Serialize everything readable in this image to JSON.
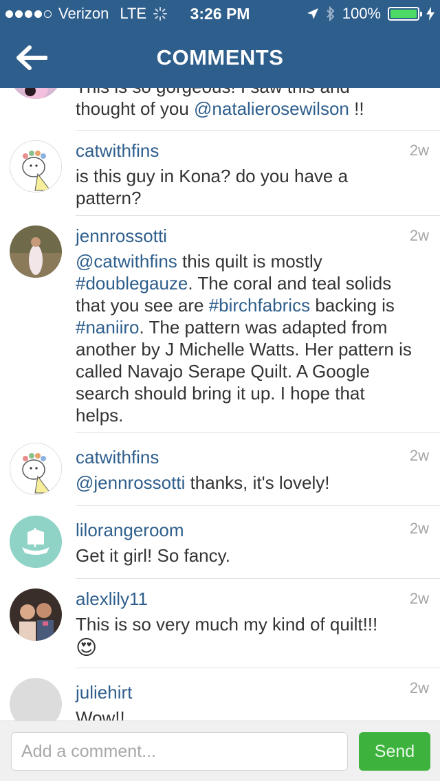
{
  "status_bar": {
    "carrier": "Verizon",
    "network": "LTE",
    "time": "3:26 PM",
    "battery": "100%"
  },
  "nav": {
    "title": "COMMENTS"
  },
  "comments": [
    {
      "partial": true,
      "username": "",
      "time": "",
      "line1": "This is so gorgeous! I saw this and",
      "line2_prefix": "thought of you ",
      "mention": "@natalierosewilson",
      "line2_suffix": " !!"
    },
    {
      "username": "catwithfins",
      "time": "2w",
      "text": "is this guy in Kona? do you have a pattern?"
    },
    {
      "username": "jennrossotti",
      "time": "2w",
      "m1": "@catwithfins",
      "t1": " this quilt is mostly ",
      "m2": "#doublegauze",
      "t2": ". The coral and teal solids that you see are ",
      "m3": "#birchfabrics",
      "t3": " backing is ",
      "m4": "#naniiro",
      "t4": ". The pattern was adapted from another by J Michelle Watts. Her pattern is called Navajo Serape Quilt. A Google search should bring it up. I hope that helps."
    },
    {
      "username": "catwithfins",
      "time": "2w",
      "mention": "@jennrossotti",
      "text": " thanks, it's lovely!"
    },
    {
      "username": "lilorangeroom",
      "time": "2w",
      "text": "Get it girl! So fancy."
    },
    {
      "username": "alexlily11",
      "time": "2w",
      "text": "This is so very much my kind of quilt!!!",
      "emoji": "😍"
    },
    {
      "username": "juliehirt",
      "time": "2w",
      "text": "Wow!!"
    }
  ],
  "compose": {
    "placeholder": "Add a comment...",
    "send_label": "Send"
  },
  "colors": {
    "nav_bg": "#2e5e8c",
    "link": "#2e5e8c",
    "send": "#3db33d"
  }
}
